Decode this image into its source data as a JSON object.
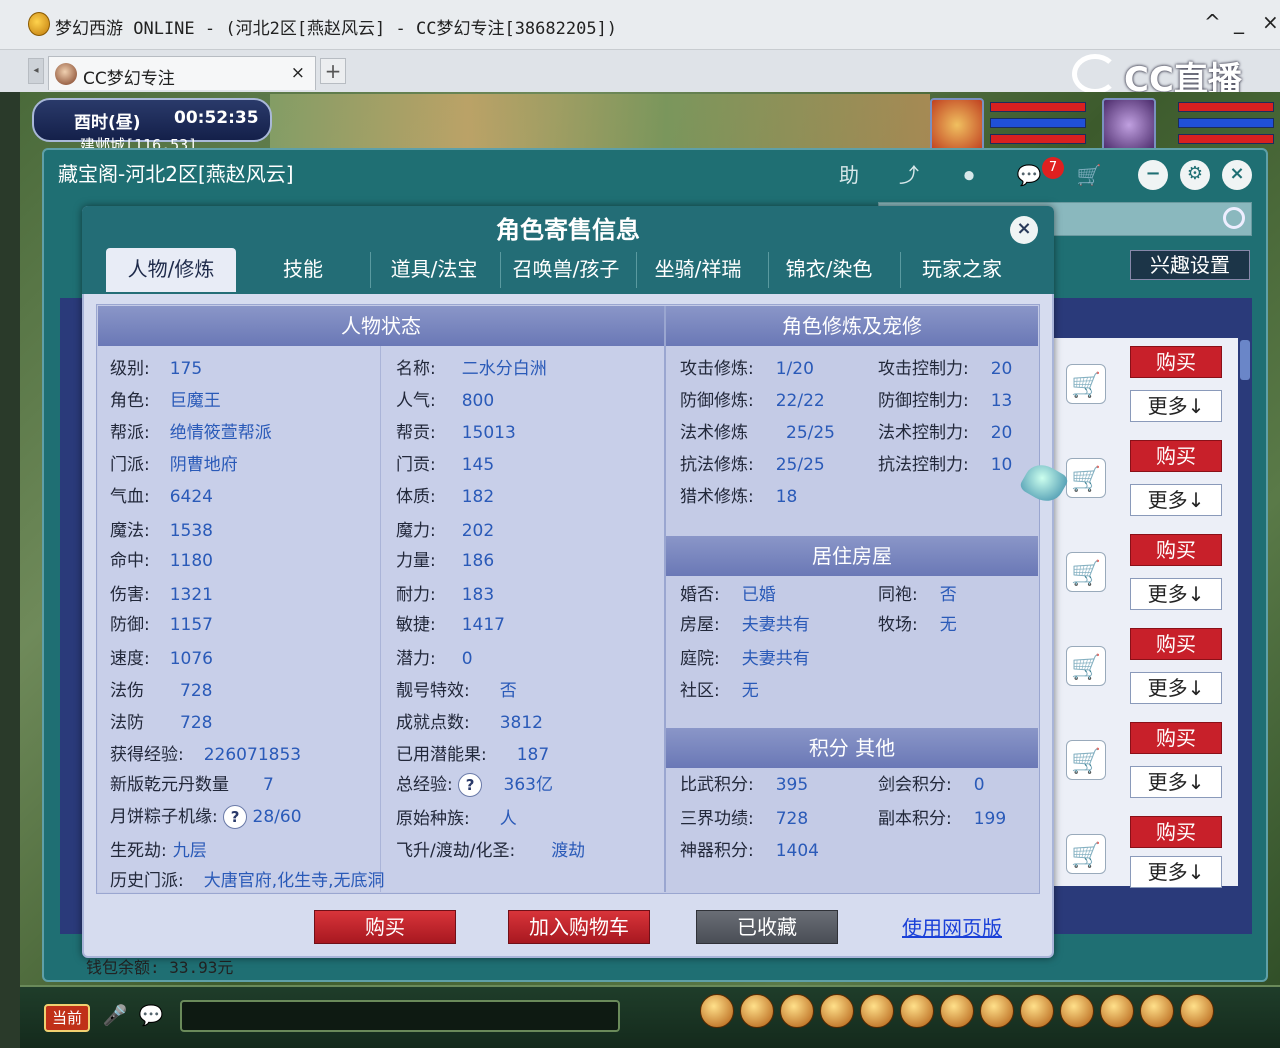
{
  "window": {
    "title": "梦幻西游 ONLINE - (河北2区[燕赵风云] - CC梦幻专注[38682205])",
    "controls": [
      "^",
      "_",
      "×"
    ]
  },
  "browser_tab": {
    "label": "CC梦幻专注",
    "close": "×",
    "new": "+"
  },
  "watermark": "CC直播",
  "game_hud": {
    "time_label": "酉时(昼)",
    "clock": "00:52:35",
    "location": "建邺城[116,53]"
  },
  "main_window": {
    "title": "藏宝阁-河北2区[燕赵风云]",
    "help": "助",
    "notification_count": "7",
    "interest_button": "兴趣设置"
  },
  "list_actions": {
    "buy": "购买",
    "more": "更多↓",
    "rows": 6
  },
  "footer_partial": "钱包余额: 33.93元",
  "bottom_bar": {
    "current": "当前"
  },
  "dialog": {
    "title": "角色寄售信息",
    "close": "×",
    "tabs": [
      "人物/修炼",
      "技能",
      "道具/法宝",
      "召唤兽/孩子",
      "坐骑/祥瑞",
      "锦衣/染色",
      "玩家之家"
    ],
    "left_section_title": "人物状态",
    "left_col1": [
      {
        "label": "级别:",
        "value": "175"
      },
      {
        "label": "角色:",
        "value": "巨魔王"
      },
      {
        "label": "帮派:",
        "value": "绝情筱萱帮派"
      },
      {
        "label": "门派:",
        "value": "阴曹地府"
      },
      {
        "label": "气血:",
        "value": "6424"
      },
      {
        "label": "魔法:",
        "value": "1538"
      },
      {
        "label": "命中:",
        "value": "1180"
      },
      {
        "label": "伤害:",
        "value": "1321"
      },
      {
        "label": "防御:",
        "value": "1157"
      },
      {
        "label": "速度:",
        "value": "1076"
      },
      {
        "label": "法伤",
        "value": "728"
      },
      {
        "label": "法防",
        "value": "728"
      },
      {
        "label": "获得经验:",
        "value": "226071853"
      },
      {
        "label": "新版乾元丹数量",
        "value": "7"
      },
      {
        "label": "月饼粽子机缘:",
        "value": "28/60"
      },
      {
        "label": "生死劫:",
        "value": "九层"
      },
      {
        "label": "历史门派:",
        "value": "大唐官府,化生寺,无底洞"
      }
    ],
    "left_col2": [
      {
        "label": "名称:",
        "value": "二水分白洲"
      },
      {
        "label": "人气:",
        "value": "800"
      },
      {
        "label": "帮贡:",
        "value": "15013"
      },
      {
        "label": "门贡:",
        "value": "145"
      },
      {
        "label": "体质:",
        "value": "182"
      },
      {
        "label": "魔力:",
        "value": "202"
      },
      {
        "label": "力量:",
        "value": "186"
      },
      {
        "label": "耐力:",
        "value": "183"
      },
      {
        "label": "敏捷:",
        "value": "1417"
      },
      {
        "label": "潜力:",
        "value": "0"
      },
      {
        "label": "靓号特效:",
        "value": "否"
      },
      {
        "label": "成就点数:",
        "value": "3812"
      },
      {
        "label": "已用潜能果:",
        "value": "187"
      },
      {
        "label": "总经验:",
        "value": "363亿"
      },
      {
        "label": "原始种族:",
        "value": "人"
      },
      {
        "label": "飞升/渡劫/化圣:",
        "value": "渡劫"
      }
    ],
    "cultivation_title": "角色修炼及宠修",
    "cultivation_left": [
      {
        "label": "攻击修炼:",
        "value": "1/20"
      },
      {
        "label": "防御修炼:",
        "value": "22/22"
      },
      {
        "label": "法术修炼",
        "value": "25/25"
      },
      {
        "label": "抗法修炼:",
        "value": "25/25"
      },
      {
        "label": "猎术修炼:",
        "value": "18"
      }
    ],
    "cultivation_right": [
      {
        "label": "攻击控制力:",
        "value": "20"
      },
      {
        "label": "防御控制力:",
        "value": "13"
      },
      {
        "label": "法术控制力:",
        "value": "20"
      },
      {
        "label": "抗法控制力:",
        "value": "10"
      }
    ],
    "house_title": "居住房屋",
    "house_left": [
      {
        "label": "婚否:",
        "value": "已婚"
      },
      {
        "label": "房屋:",
        "value": "夫妻共有"
      },
      {
        "label": "庭院:",
        "value": "夫妻共有"
      },
      {
        "label": "社区:",
        "value": "无"
      }
    ],
    "house_right": [
      {
        "label": "同袍:",
        "value": "否"
      },
      {
        "label": "牧场:",
        "value": "无"
      }
    ],
    "points_title": "积分 其他",
    "points_left": [
      {
        "label": "比武积分:",
        "value": "395"
      },
      {
        "label": "三界功绩:",
        "value": "728"
      },
      {
        "label": "神器积分:",
        "value": "1404"
      }
    ],
    "points_right": [
      {
        "label": "剑会积分:",
        "value": "0"
      },
      {
        "label": "副本积分:",
        "value": "199"
      }
    ],
    "buttons": {
      "buy": "购买",
      "add_cart": "加入购物车",
      "collected": "已收藏",
      "web": "使用网页版"
    }
  }
}
